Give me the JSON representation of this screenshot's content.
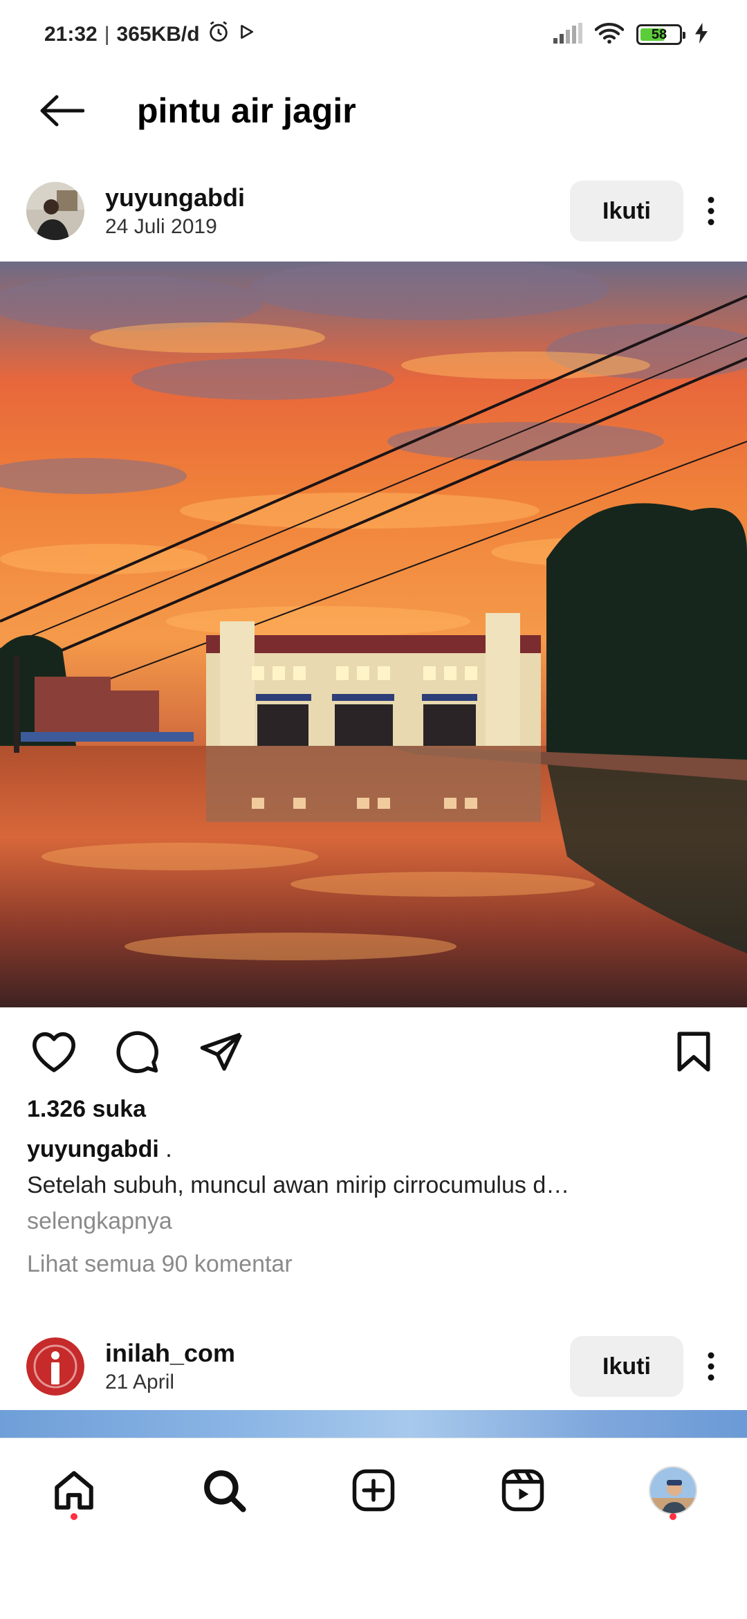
{
  "status_bar": {
    "time": "21:32",
    "separator": "|",
    "data_rate": "365KB/d",
    "battery_level": "58",
    "icons": [
      "alarm-icon",
      "play-icon",
      "signal-icon",
      "wifi-icon",
      "battery-icon",
      "charging-icon"
    ]
  },
  "header": {
    "title": "pintu air jagir",
    "back_icon": "arrow-left-icon"
  },
  "posts": [
    {
      "username": "yuyungabdi",
      "date": "24 Juli 2019",
      "follow_label": "Ikuti",
      "likes": "1.326 suka",
      "caption_user": "yuyungabdi",
      "caption_suffix": " .",
      "caption_text": "Setelah subuh, muncul awan mirip cirrocumulus d…",
      "more_label": "selengkapnya",
      "comments_label": "Lihat semua 90 komentar"
    },
    {
      "username": "inilah_com",
      "date": "21 April",
      "follow_label": "Ikuti"
    }
  ],
  "actions": {
    "icons": [
      "heart-icon",
      "comment-icon",
      "share-icon",
      "bookmark-icon"
    ]
  },
  "bottom_nav": {
    "items": [
      "home",
      "search",
      "create",
      "reels",
      "profile"
    ]
  },
  "colors": {
    "accent_dot": "#ff3040",
    "follow_bg": "#efefef",
    "muted_text": "#8a8a8a",
    "battery_fill": "#5ccd3a"
  }
}
